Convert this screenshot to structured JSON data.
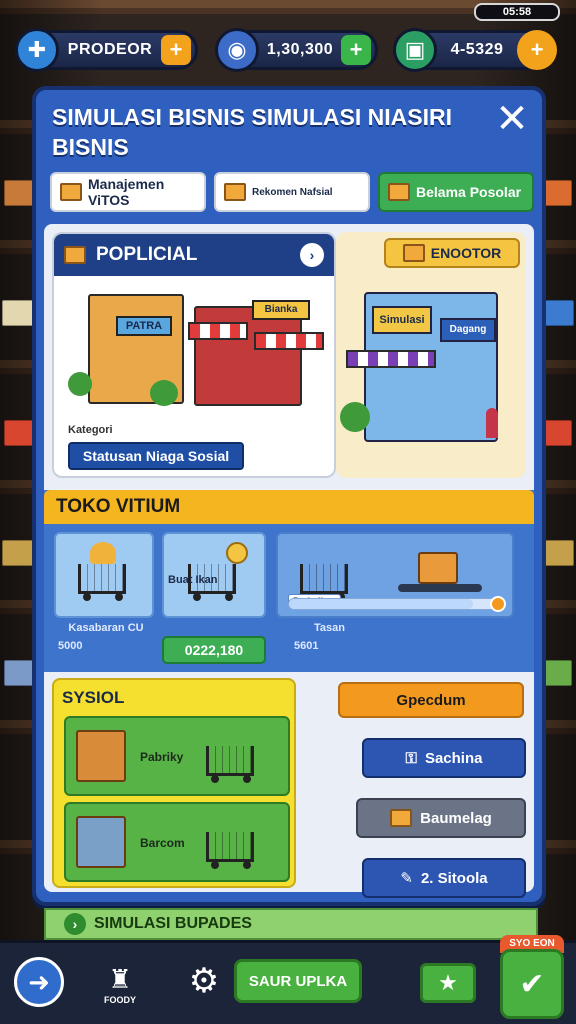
{
  "corner_label": "05:58",
  "resources": [
    {
      "icon": "puzzle-icon",
      "value": "PRODEOR",
      "plus": "+"
    },
    {
      "icon": "coin-icon",
      "value": "1,30,300",
      "plus": "+"
    },
    {
      "icon": "cash-icon",
      "value": "4-5329",
      "plus": "+"
    }
  ],
  "panel": {
    "title": "SIMULASI BISNIS SIMULASI NIASIRI BISNIS",
    "close": "✕"
  },
  "tabs": [
    {
      "label": "Manajemen ViTOS",
      "active": false
    },
    {
      "label": "Rekomen Nafsial",
      "active": false
    },
    {
      "label": "Belama Posolar",
      "active": true
    }
  ],
  "popular_card": {
    "title": "POPLICIAL",
    "arrow": "›",
    "small_label": "Kategori",
    "button": "Statusan Niaga Sosial",
    "shop_sign_1": "PATRA",
    "shop_sign_2": "Bianka"
  },
  "encounter_card": {
    "badge": "ENOOTOR",
    "store_sign": "Simulasi",
    "store_sign_2": "Dagang"
  },
  "toko": {
    "title": "TOKO VITIUM",
    "items": [
      {
        "label": "Kasabaran CU",
        "sub": "5000"
      },
      {
        "label": "Buat Ikan",
        "price": "0222,180"
      },
      {
        "label": "Tasan",
        "sub": "5601",
        "progress_label": "Perbaikan"
      }
    ],
    "progress": 0.86
  },
  "sysiol": {
    "title": "SYSIOL",
    "rows": [
      {
        "label": "Pabriky"
      },
      {
        "label": "Barcom"
      }
    ]
  },
  "right_buttons": [
    {
      "label": "Gpecdum",
      "icon": ""
    },
    {
      "label": "Sachina",
      "icon": "key-icon"
    },
    {
      "label": "Baumelag",
      "icon": "box-icon"
    },
    {
      "label": "2. Sitoola",
      "icon": "pencil-icon"
    }
  ],
  "status_bar": {
    "text": "SIMULASI BUPADES"
  },
  "bottom_nav": {
    "store_label": "FOODY",
    "main_button": "SAUR UPLKA",
    "play_tag": "SYO EON"
  },
  "colors": {
    "panel_blue": "#2f5fbf",
    "accent_yellow": "#f4b51f",
    "green": "#49b13f",
    "orange": "#f39a1e"
  }
}
